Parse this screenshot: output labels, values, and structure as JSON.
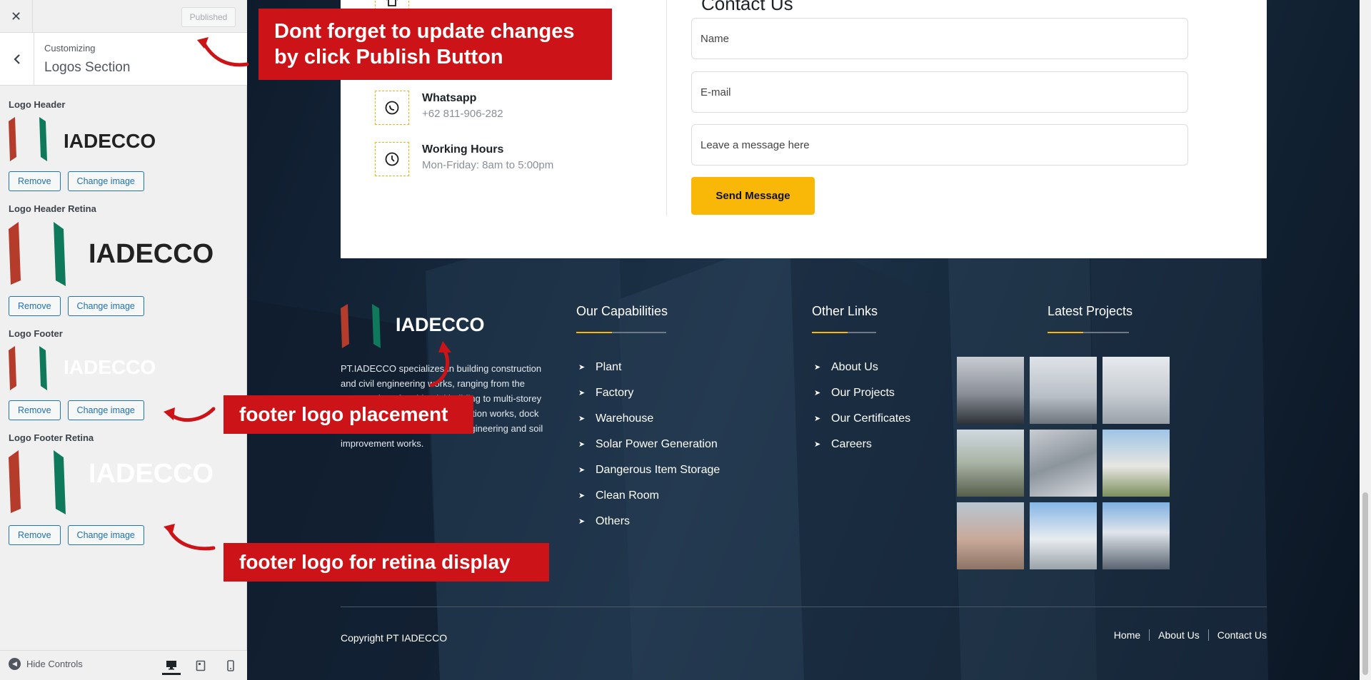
{
  "sidebar": {
    "published_label": "Published",
    "customizing_label": "Customizing",
    "section_title": "Logos Section",
    "controls": [
      {
        "label": "Logo Header",
        "remove": "Remove",
        "change": "Change image"
      },
      {
        "label": "Logo Header Retina",
        "remove": "Remove",
        "change": "Change image"
      },
      {
        "label": "Logo Footer",
        "remove": "Remove",
        "change": "Change image"
      },
      {
        "label": "Logo Footer Retina",
        "remove": "Remove",
        "change": "Change image"
      }
    ],
    "hide_controls": "Hide Controls"
  },
  "brand": {
    "logo_text": "IADECCO",
    "red": "#b53b2a",
    "green": "#0f7a5b",
    "accent": "#f9b808",
    "callout": "#cc1418"
  },
  "contact": {
    "heading": "Contact Us",
    "items": [
      {
        "title": "Whatsapp",
        "text": "+62 811-906-282",
        "icon": "whatsapp-icon"
      },
      {
        "title": "Working Hours",
        "text": "Mon-Friday: 8am to 5:00pm",
        "icon": "clock-icon"
      }
    ],
    "form": {
      "name": "Name",
      "email": "E-mail",
      "message": "Leave a message here",
      "submit": "Send Message"
    }
  },
  "footer": {
    "about": "PT.IADECCO specializes in building construction and civil engineering works, ranging from the construction of residential building to multi-storey buildings, dredging and reclamation works, dock construction, and foundation engineering and soil improvement works.",
    "capabilities": {
      "title": "Our Capabilities",
      "items": [
        "Plant",
        "Factory",
        "Warehouse",
        "Solar Power Generation",
        "Dangerous Item Storage",
        "Clean Room",
        "Others"
      ]
    },
    "other_links": {
      "title": "Other Links",
      "items": [
        "About Us",
        "Our Projects",
        "Our Certificates",
        "Careers"
      ]
    },
    "latest_projects": {
      "title": "Latest Projects"
    },
    "copyright": "Copyright PT IADECCO",
    "bottom_nav": [
      "Home",
      "About Us",
      "Contact Us"
    ]
  },
  "annotations": {
    "publish": "Dont forget to update changes by click Publish Button",
    "footer_logo": "footer logo placement",
    "retina": "footer logo for retina display"
  }
}
